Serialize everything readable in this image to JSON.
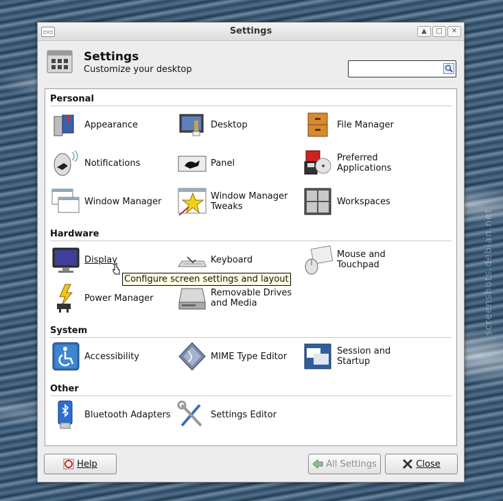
{
  "window": {
    "title": "Settings"
  },
  "header": {
    "title": "Settings",
    "subtitle": "Customize your desktop",
    "search_value": ""
  },
  "sections": {
    "personal": "Personal",
    "hardware": "Hardware",
    "system": "System",
    "other": "Other"
  },
  "items": {
    "appearance": "Appearance",
    "desktop": "Desktop",
    "file_manager": "File Manager",
    "notifications": "Notifications",
    "panel": "Panel",
    "preferred_apps": "Preferred\nApplications",
    "window_manager": "Window Manager",
    "wm_tweaks": "Window Manager\nTweaks",
    "workspaces": "Workspaces",
    "display": "Display",
    "keyboard": "Keyboard",
    "mouse": "Mouse and\nTouchpad",
    "power_manager": "Power Manager",
    "removable": "Removable Drives\nand Media",
    "accessibility": "Accessibility",
    "mime": "MIME Type Editor",
    "session": "Session and\nStartup",
    "bluetooth": "Bluetooth Adapters",
    "settings_editor": "Settings Editor"
  },
  "tooltip": "Configure screen settings and layout",
  "footer": {
    "help": "Help",
    "all_settings": "All Settings",
    "close": "Close"
  },
  "watermark": "screenshots.debian.net",
  "icons": {
    "window_menu": "window-menu-icon",
    "shade": "shade-icon",
    "maximize": "maximize-icon",
    "close": "close-icon",
    "search": "search-icon"
  }
}
